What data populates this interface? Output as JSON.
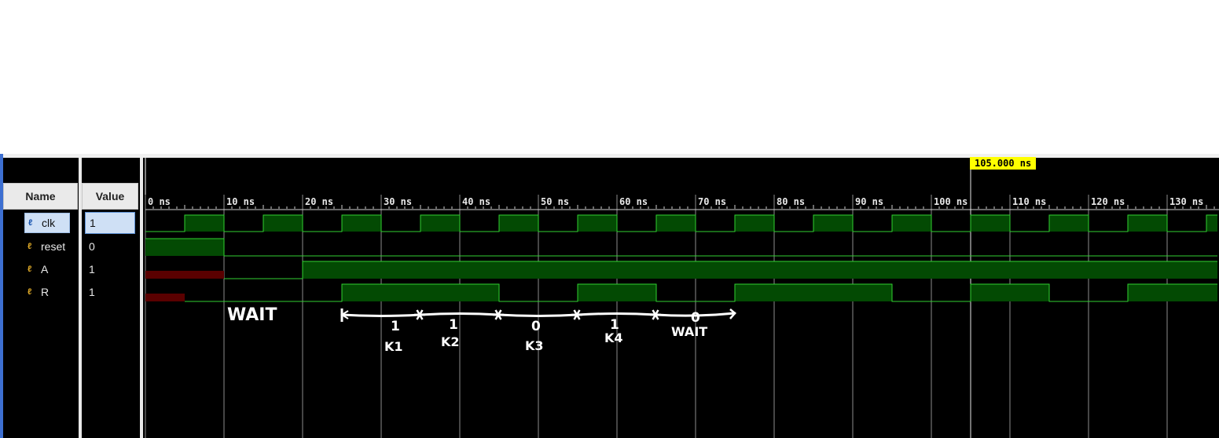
{
  "columns": {
    "name_header": "Name",
    "value_header": "Value"
  },
  "cursor": {
    "label": "105.000 ns",
    "time_ns": 105
  },
  "timeline": {
    "unit": "ns",
    "start_ns": 0,
    "end_ns": 136.4,
    "ticks": [
      "0 ns",
      "10 ns",
      "20 ns",
      "30 ns",
      "40 ns",
      "50 ns",
      "60 ns",
      "70 ns",
      "80 ns",
      "90 ns",
      "100 ns",
      "110 ns",
      "120 ns",
      "130 ns"
    ]
  },
  "signals": [
    {
      "name": "clk",
      "value": "1",
      "selected": true,
      "icon": "signal-icon",
      "segments": [
        [
          0,
          5,
          "0"
        ],
        [
          5,
          10,
          "1"
        ],
        [
          10,
          15,
          "0"
        ],
        [
          15,
          20,
          "1"
        ],
        [
          20,
          25,
          "0"
        ],
        [
          25,
          30,
          "1"
        ],
        [
          30,
          35,
          "0"
        ],
        [
          35,
          40,
          "1"
        ],
        [
          40,
          45,
          "0"
        ],
        [
          45,
          50,
          "1"
        ],
        [
          50,
          55,
          "0"
        ],
        [
          55,
          60,
          "1"
        ],
        [
          60,
          65,
          "0"
        ],
        [
          65,
          70,
          "1"
        ],
        [
          70,
          75,
          "0"
        ],
        [
          75,
          80,
          "1"
        ],
        [
          80,
          85,
          "0"
        ],
        [
          85,
          90,
          "1"
        ],
        [
          90,
          95,
          "0"
        ],
        [
          95,
          100,
          "1"
        ],
        [
          100,
          105,
          "0"
        ],
        [
          105,
          110,
          "1"
        ],
        [
          110,
          115,
          "0"
        ],
        [
          115,
          120,
          "1"
        ],
        [
          120,
          125,
          "0"
        ],
        [
          125,
          130,
          "1"
        ],
        [
          130,
          135,
          "0"
        ],
        [
          135,
          136.4,
          "1"
        ]
      ]
    },
    {
      "name": "reset",
      "value": "0",
      "selected": false,
      "icon": "signal-icon",
      "segments": [
        [
          0,
          10,
          "1"
        ],
        [
          10,
          136.4,
          "0"
        ]
      ]
    },
    {
      "name": "A",
      "value": "1",
      "selected": false,
      "icon": "signal-icon",
      "segments": [
        [
          0,
          10,
          "X"
        ],
        [
          10,
          20,
          "0"
        ],
        [
          20,
          136.4,
          "1"
        ]
      ]
    },
    {
      "name": "R",
      "value": "1",
      "selected": false,
      "icon": "signal-icon",
      "segments": [
        [
          0,
          5,
          "X"
        ],
        [
          5,
          25,
          "0"
        ],
        [
          25,
          45,
          "1"
        ],
        [
          45,
          55,
          "0"
        ],
        [
          55,
          65,
          "1"
        ],
        [
          65,
          75,
          "0"
        ],
        [
          75,
          95,
          "1"
        ],
        [
          95,
          105,
          "0"
        ],
        [
          105,
          115,
          "1"
        ],
        [
          115,
          125,
          "0"
        ],
        [
          125,
          136.4,
          "1"
        ]
      ]
    }
  ],
  "annotations": {
    "wait_label_1": "WAIT",
    "segment_values": [
      "1",
      "1",
      "0",
      "1",
      "0"
    ],
    "segment_labels": [
      "K1",
      "K2",
      "K3",
      "K4",
      "WAIT"
    ]
  },
  "colors": {
    "wave_high_fill": "#034a03",
    "wave_line": "#32d032",
    "unknown_fill": "#5a0000",
    "cursor_label_bg": "#ffff00",
    "grid": "#8c8c8c"
  }
}
